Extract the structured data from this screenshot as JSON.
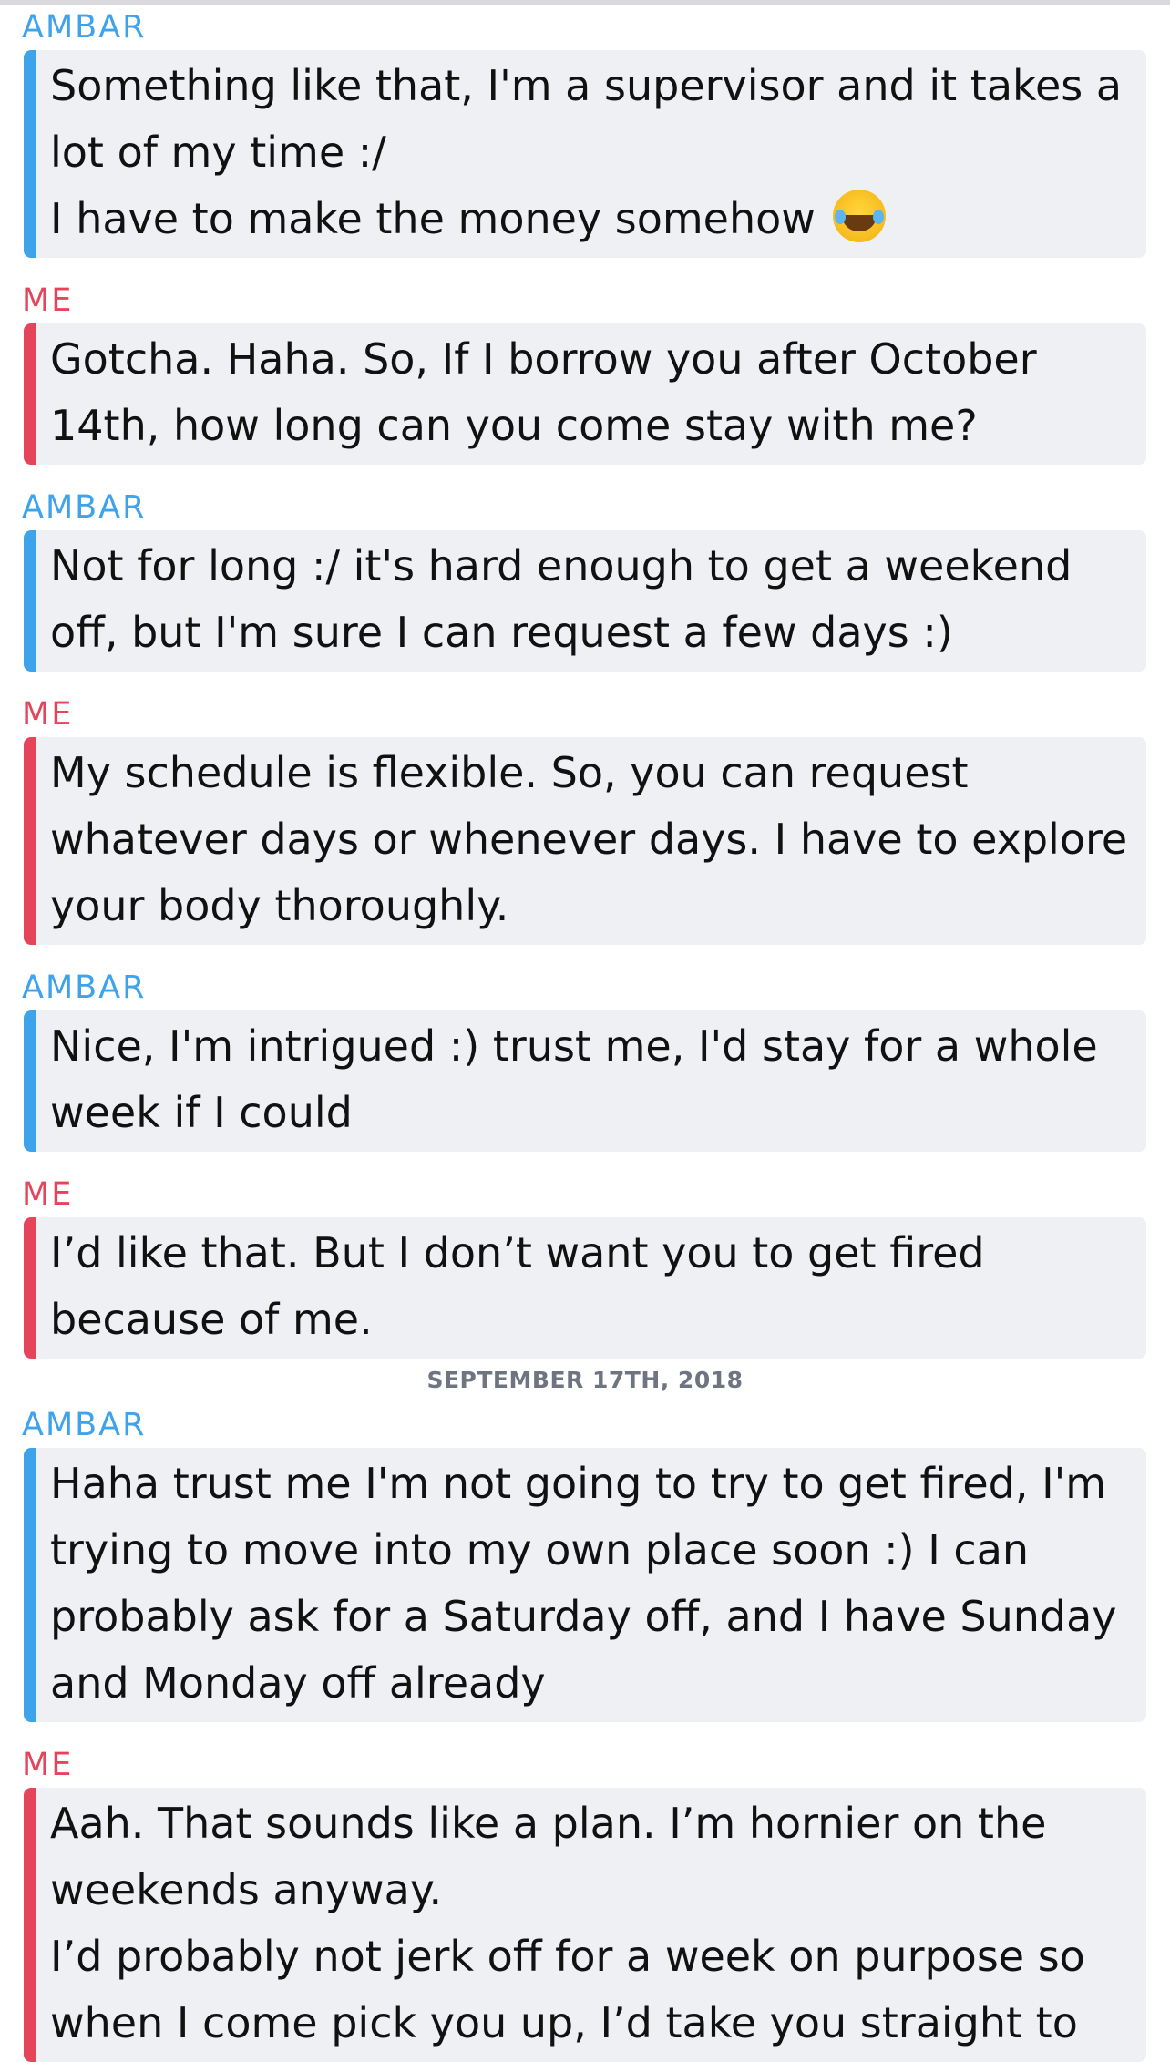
{
  "colors": {
    "them_accent": "#3fa3ec",
    "me_accent": "#e4455a",
    "bubble_bg": "#eef0f4"
  },
  "messages": [
    {
      "sender": "AMBAR",
      "from": "them",
      "text": "Something like that, I'm a supervisor and it takes a lot of my time :/\nI have to make the money somehow",
      "emoji": "face-with-tears-of-joy-icon"
    },
    {
      "sender": "ME",
      "from": "me",
      "text": "Gotcha. Haha. So, If I borrow you after October 14th, how long can you come stay with me?"
    },
    {
      "sender": "AMBAR",
      "from": "them",
      "text": "Not for long :/ it's hard enough to get a weekend off, but I'm sure I can request a few days :)"
    },
    {
      "sender": "ME",
      "from": "me",
      "text": "My schedule is flexible. So, you can request whatever days or whenever days. I have to explore your body thoroughly."
    },
    {
      "sender": "AMBAR",
      "from": "them",
      "text": "Nice, I'm intrigued :) trust me, I'd stay for a whole week if I could"
    },
    {
      "sender": "ME",
      "from": "me",
      "text": "I’d like that. But I don’t want you to get fired because of me."
    },
    {
      "divider": "SEPTEMBER 17TH, 2018"
    },
    {
      "sender": "AMBAR",
      "from": "them",
      "text": "Haha trust me I'm not going to try to get fired, I'm trying to move into my own place soon :) I can probably ask for a Saturday off, and I have Sunday and Monday off already"
    },
    {
      "sender": "ME",
      "from": "me",
      "text": "Aah. That sounds like a plan. I’m hornier on the weekends anyway.\nI’d probably not jerk off for a week on purpose so when I come pick you up, I’d take you straight to"
    }
  ]
}
